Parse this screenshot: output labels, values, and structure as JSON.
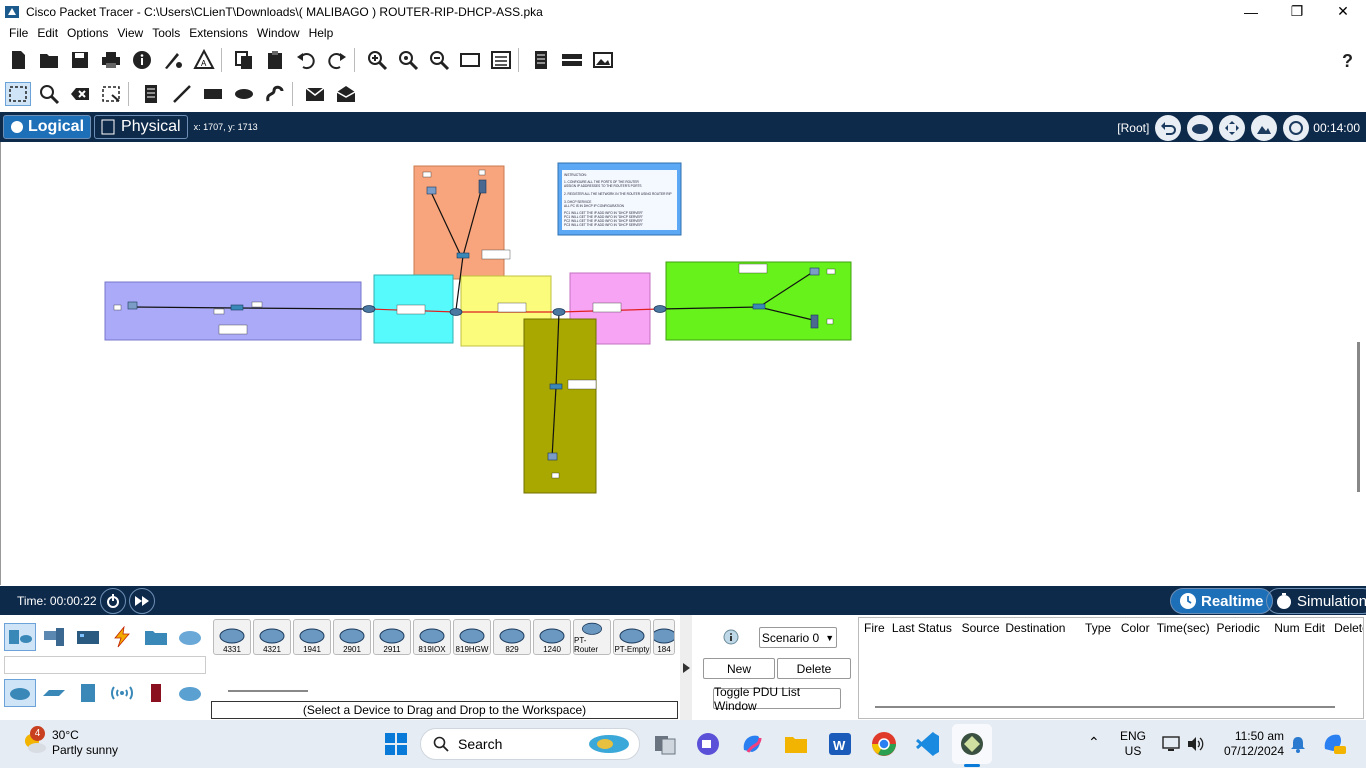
{
  "window": {
    "title": "Cisco Packet Tracer - C:\\Users\\CLienT\\Downloads\\( MALIBAGO ) ROUTER-RIP-DHCP-ASS.pka"
  },
  "menu": [
    "File",
    "Edit",
    "Options",
    "View",
    "Tools",
    "Extensions",
    "Window",
    "Help"
  ],
  "modebar": {
    "logical": "Logical",
    "physical": "Physical",
    "coords": "x: 1707, y: 1713",
    "root": "[Root]",
    "clock": "00:14:00"
  },
  "timebar": {
    "time": "Time: 00:00:22",
    "realtime": "Realtime",
    "simulation": "Simulation"
  },
  "devices": [
    "4331",
    "4321",
    "1941",
    "2901",
    "2911",
    "819IOX",
    "819HGW",
    "829",
    "1240",
    "PT-Router",
    "PT-Empty",
    "184"
  ],
  "device_hint": "(Select a Device to Drag and Drop to the Workspace)",
  "pdu": {
    "scenario": "Scenario 0",
    "new": "New",
    "delete": "Delete",
    "toggle": "Toggle PDU List Window",
    "columns": [
      "Fire",
      "Last Status",
      "Source",
      "Destination",
      "Type",
      "Color",
      "Time(sec)",
      "Periodic",
      "Num",
      "Edit",
      "Delete"
    ]
  },
  "taskbar": {
    "temp": "30°C",
    "weather": "Partly sunny",
    "badge": "4",
    "search": "Search",
    "lang": "ENG",
    "region": "US",
    "time": "11:50 am",
    "date": "07/12/2024"
  },
  "topology": {
    "instructions": [
      "INSTRUCTION:",
      "1. CONFIGURE ALL THE PORTS OF THE ROUTER",
      "   ASSIGN IP ADDRESSES TO THE ROUTER'S PORTS",
      "2. REGISTER ALL THE NETWORK IN THE ROUTER USING ROUTER RIP",
      "3. DHCP SERVICE",
      "ALL PC IS IN DHCP IP CONFIGURATION",
      "PC1 WILL GET THE IP ADD INFO IN \"DHCP SERVER\"",
      "PC1 WILL GET THE IP ADD INFO IN \"DHCP SERVER\"",
      "PC2 WILL GET THE IP ADD INFO IN \"DHCP SERVER\"",
      "PC3 WILL GET THE IP ADD INFO IN \"DHCP SERVER\""
    ],
    "colors": {
      "purple": "#aaaaf8",
      "orange": "#f8a47c",
      "cyan": "#56fafc",
      "yellow": "#fcfc7c",
      "pink": "#f8a4f4",
      "green": "#66f21a",
      "olive": "#a8a800",
      "note": "#5ca8f4"
    }
  }
}
